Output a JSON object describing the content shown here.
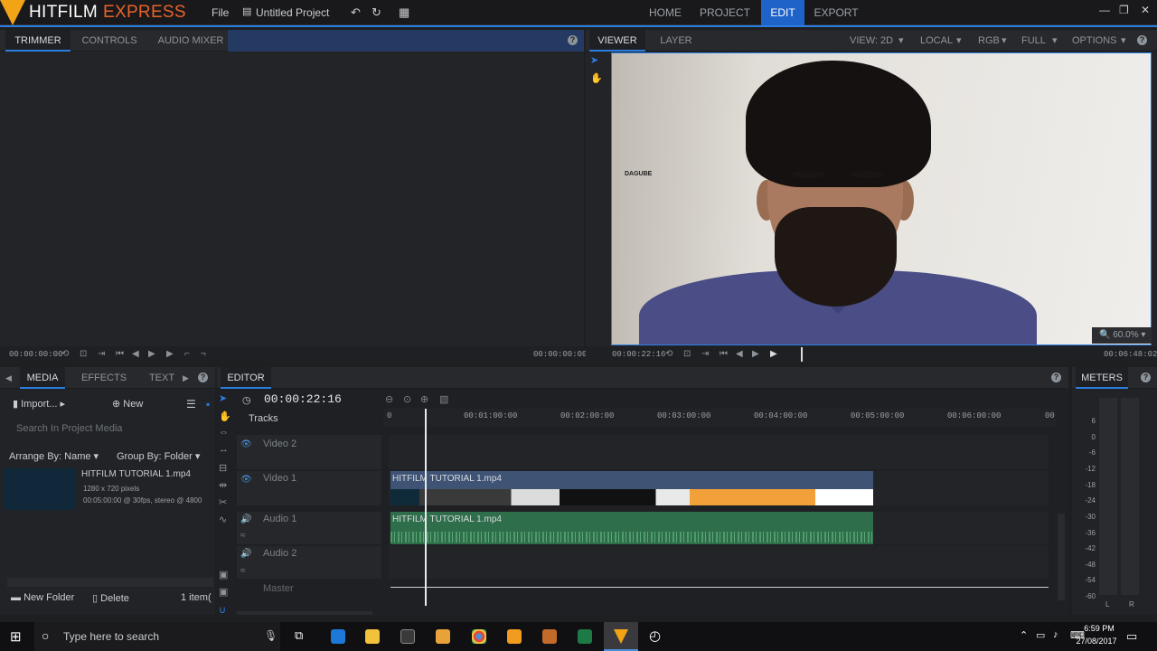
{
  "app": {
    "logo_part1": "HITFILM",
    "logo_part2": "EXPRESS",
    "file_menu": "File",
    "project_name": "Untitled Project"
  },
  "nav": {
    "tabs": [
      {
        "label": "HOME"
      },
      {
        "label": "PROJECT"
      },
      {
        "label": "EDIT"
      },
      {
        "label": "EXPORT"
      }
    ],
    "active": "EDIT"
  },
  "trimmer": {
    "tabs": [
      "TRIMMER",
      "CONTROLS",
      "AUDIO MIXER"
    ],
    "tc_left": "00:00:00:00",
    "tc_right": "00:00:00:00"
  },
  "viewer": {
    "tabs": [
      "VIEWER",
      "LAYER"
    ],
    "options": {
      "view": "VIEW: 2D",
      "space": "LOCAL",
      "channel": "RGB",
      "quality": "FULL",
      "options": "OPTIONS"
    },
    "watermark": "DAGUBE",
    "zoom": "60.0%",
    "tc_current": "00:00:22:16",
    "tc_end": "00:06:48:02"
  },
  "media": {
    "tabs": [
      "MEDIA",
      "EFFECTS",
      "TEXT"
    ],
    "import_label": "Import...",
    "new_label": "New",
    "search_placeholder": "Search In Project Media",
    "arrange": "Arrange By: Name",
    "group": "Group By: Folder",
    "item": {
      "name": "HITFILM TUTORIAL 1.mp4",
      "dims": "1280 x 720 pixels",
      "info": "00:05:00:00 @ 30fps, stereo @ 4800"
    },
    "new_folder": "New Folder",
    "delete": "Delete",
    "count": "1 item("
  },
  "editor": {
    "title": "EDITOR",
    "timecode": "00:00:22:16",
    "tracks_label": "Tracks",
    "tracks": [
      "Video 2",
      "Video 1",
      "Audio 1",
      "Audio 2",
      "Master"
    ],
    "ruler": [
      "0",
      "00:01:00:00",
      "00:02:00:00",
      "00:03:00:00",
      "00:04:00:00",
      "00:05:00:00",
      "00:06:00:00",
      "00"
    ],
    "video_clip": "HITFILM TUTORIAL 1.mp4",
    "audio_clip": "HITFILM TUTORIAL 1.mp4"
  },
  "meters": {
    "title": "METERS",
    "scale": [
      "6",
      "0",
      "-6",
      "-12",
      "-18",
      "-24",
      "-30",
      "-36",
      "-42",
      "-48",
      "-54",
      "-60"
    ],
    "left": "L",
    "right": "R"
  },
  "taskbar": {
    "search_placeholder": "Type here to search",
    "time": "6:59 PM",
    "date": "27/08/2017"
  },
  "colors": {
    "accent": "#2a7de1",
    "active_tab": "#1f63c8",
    "video_clip": "#3f5475",
    "audio_clip": "#2f6e4a",
    "brand_orange": "#e8622c"
  }
}
